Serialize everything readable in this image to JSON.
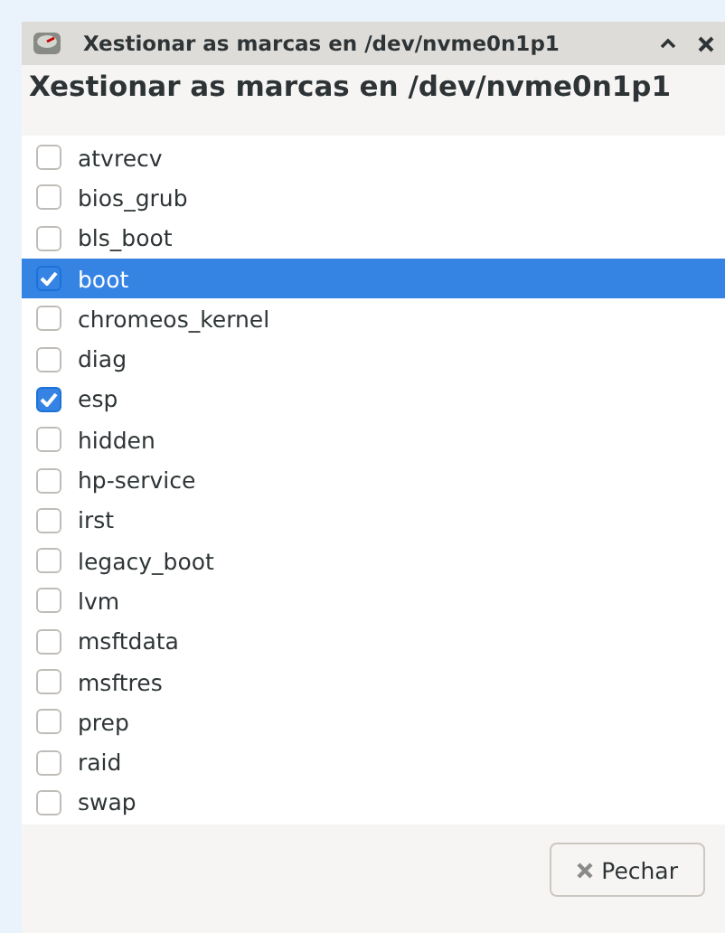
{
  "window": {
    "title": "Xestionar as marcas en /dev/nvme0n1p1"
  },
  "heading": "Xestionar as marcas en /dev/nvme0n1p1",
  "flags": [
    {
      "label": "atvrecv",
      "checked": false,
      "selected": false
    },
    {
      "label": "bios_grub",
      "checked": false,
      "selected": false
    },
    {
      "label": "bls_boot",
      "checked": false,
      "selected": false
    },
    {
      "label": "boot",
      "checked": true,
      "selected": true
    },
    {
      "label": "chromeos_kernel",
      "checked": false,
      "selected": false
    },
    {
      "label": "diag",
      "checked": false,
      "selected": false
    },
    {
      "label": "esp",
      "checked": true,
      "selected": false
    },
    {
      "label": "hidden",
      "checked": false,
      "selected": false
    },
    {
      "label": "hp-service",
      "checked": false,
      "selected": false
    },
    {
      "label": "irst",
      "checked": false,
      "selected": false
    },
    {
      "label": "legacy_boot",
      "checked": false,
      "selected": false
    },
    {
      "label": "lvm",
      "checked": false,
      "selected": false
    },
    {
      "label": "msftdata",
      "checked": false,
      "selected": false
    },
    {
      "label": "msftres",
      "checked": false,
      "selected": false
    },
    {
      "label": "prep",
      "checked": false,
      "selected": false
    },
    {
      "label": "raid",
      "checked": false,
      "selected": false
    },
    {
      "label": "swap",
      "checked": false,
      "selected": false
    }
  ],
  "buttons": [
    {
      "label": "Pechar"
    }
  ]
}
